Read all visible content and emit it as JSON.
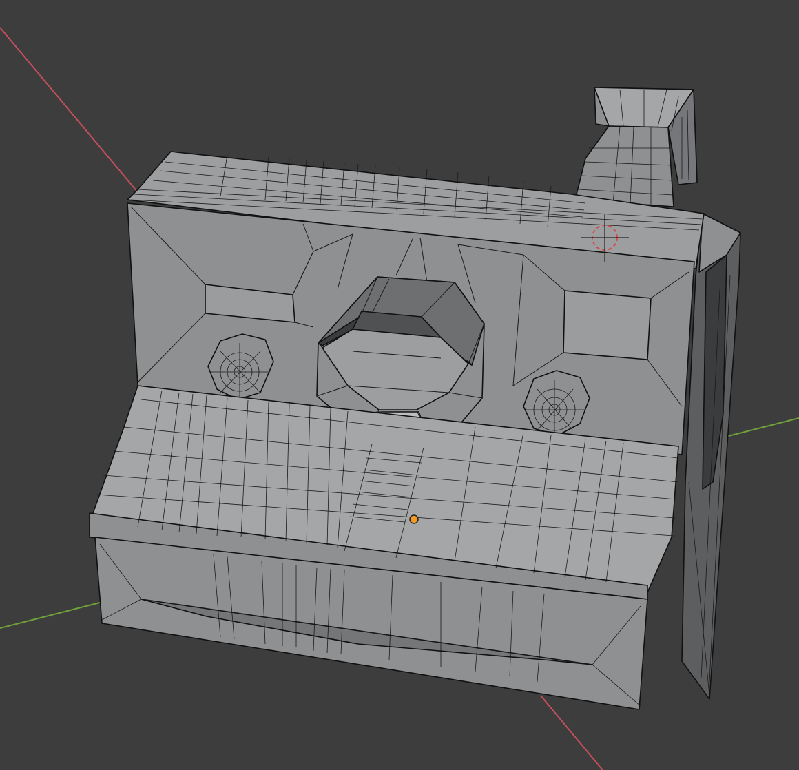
{
  "viewport": {
    "background": "#3d3d3d",
    "mesh_face_color": "#8e9091",
    "mesh_face_light": "#a4a6a7",
    "mesh_face_dark": "#5c5e60",
    "mesh_face_darker": "#3b3c3d",
    "wire_color": "#111111",
    "x_axis_color": "#c4505e",
    "y_axis_color": "#6fa23a",
    "origin_color": "#f59a23",
    "cursor_color": "#d24b4b"
  }
}
